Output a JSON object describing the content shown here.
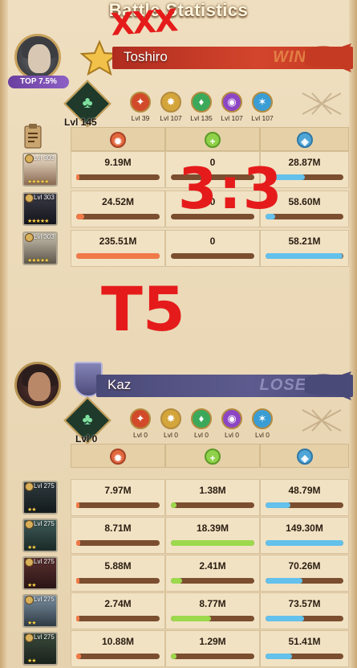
{
  "title": "Battle Statistics",
  "annotations": {
    "crossout": "XXX",
    "score": "3:3",
    "tier": "T5"
  },
  "columns": [
    "damage-icon",
    "healing-icon",
    "shield-icon"
  ],
  "colors": {
    "damage": "#f07a48",
    "healing": "#9cd94d",
    "shield": "#63c1ec",
    "win_banner": "#c43a22",
    "lose_banner": "#5d5b8e"
  },
  "winner": {
    "name": "Toshiro",
    "result": "WIN",
    "top_badge": "TOP 7.5%",
    "faction_level": "Lvl 145",
    "faction_levels": [
      "Lvl 39",
      "Lvl 107",
      "Lvl 135",
      "Lvl 107",
      "Lvl 107"
    ],
    "heroes": [
      {
        "level": "Lvl 303",
        "stars": "★★★★★",
        "damage": "9.19M",
        "healing": "0",
        "shield": "28.87M",
        "damage_pct": 0.04,
        "healing_pct": 0,
        "shield_pct": 0.5
      },
      {
        "level": "Lvl 303",
        "stars": "★★★★★",
        "damage": "24.52M",
        "healing": "0",
        "shield": "58.60M",
        "damage_pct": 0.1,
        "healing_pct": 0,
        "shield_pct": 0.12
      },
      {
        "level": "Lvl 303",
        "stars": "★★★★★",
        "damage": "235.51M",
        "healing": "0",
        "shield": "58.21M",
        "damage_pct": 1.0,
        "healing_pct": 0,
        "shield_pct": 0.99
      }
    ]
  },
  "loser": {
    "name": "Kaz",
    "result": "LOSE",
    "faction_level": "Lvl 0",
    "faction_levels": [
      "Lvl 0",
      "Lvl 0",
      "Lvl 0",
      "Lvl 0",
      "Lvl 0"
    ],
    "heroes": [
      {
        "level": "Lvl 275",
        "stars": "★★",
        "damage": "7.97M",
        "healing": "1.38M",
        "shield": "48.79M",
        "damage_pct": 0.04,
        "healing_pct": 0.07,
        "shield_pct": 0.32
      },
      {
        "level": "Lvl 275",
        "stars": "★★",
        "damage": "8.71M",
        "healing": "18.39M",
        "shield": "149.30M",
        "damage_pct": 0.05,
        "healing_pct": 1.0,
        "shield_pct": 1.0
      },
      {
        "level": "Lvl 275",
        "stars": "★★",
        "damage": "5.88M",
        "healing": "2.41M",
        "shield": "70.26M",
        "damage_pct": 0.03,
        "healing_pct": 0.13,
        "shield_pct": 0.47
      },
      {
        "level": "Lvl 275",
        "stars": "★★",
        "damage": "2.74M",
        "healing": "8.77M",
        "shield": "73.57M",
        "damage_pct": 0.02,
        "healing_pct": 0.48,
        "shield_pct": 0.49
      },
      {
        "level": "Lvl 275",
        "stars": "★★",
        "damage": "10.88M",
        "healing": "1.29M",
        "shield": "51.41M",
        "damage_pct": 0.06,
        "healing_pct": 0.07,
        "shield_pct": 0.34
      }
    ]
  }
}
